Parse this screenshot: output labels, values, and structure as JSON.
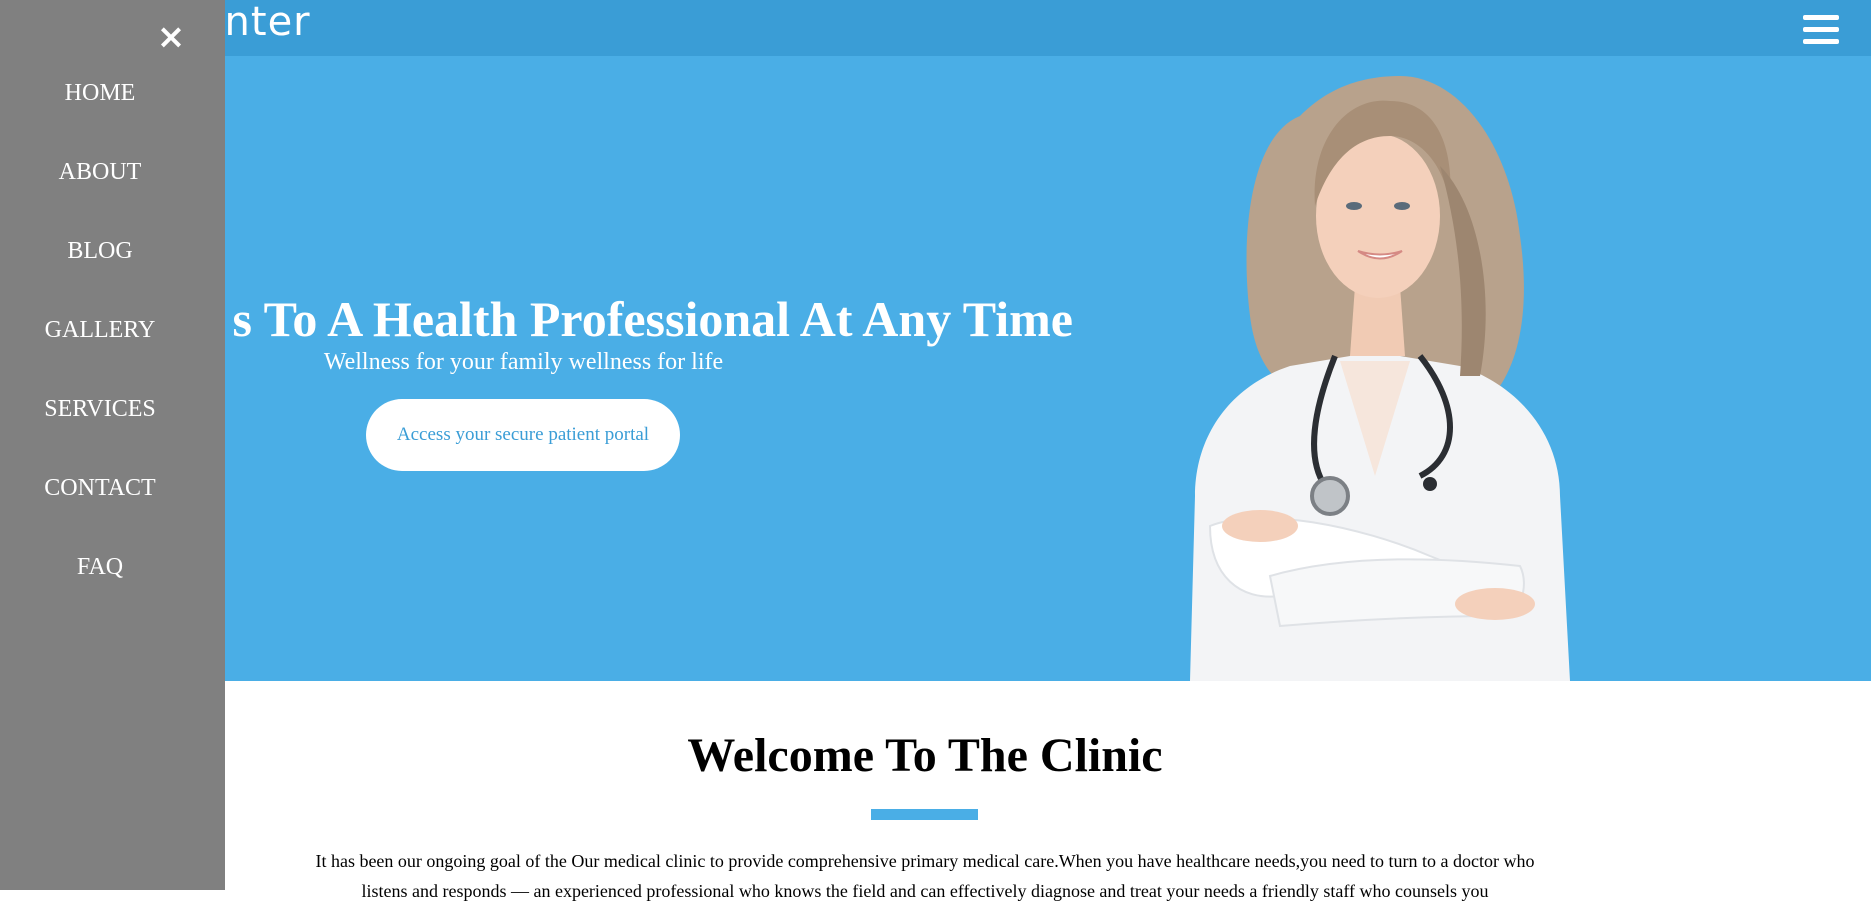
{
  "header": {
    "logo_text": "Center"
  },
  "sidebar": {
    "close_symbol": "×",
    "items": [
      {
        "label": "HOME"
      },
      {
        "label": "ABOUT"
      },
      {
        "label": "BLOG"
      },
      {
        "label": "GALLERY"
      },
      {
        "label": "SERVICES"
      },
      {
        "label": "CONTACT"
      },
      {
        "label": "FAQ"
      }
    ]
  },
  "hero": {
    "title": "s To A Health Professional At Any Time",
    "subtitle": "Wellness for your family wellness for life",
    "cta_label": "Access your secure patient portal"
  },
  "welcome": {
    "title": "Welcome To The Clinic",
    "text": "It has been our ongoing goal of the Our medical clinic to provide comprehensive primary medical care.When you have healthcare needs,you need to turn to a doctor who listens and responds — an experienced professional who knows the field and can effectively diagnose and treat your needs a friendly staff who counsels you"
  },
  "colors": {
    "topbar": "#3a9dd6",
    "hero_bg": "#4aaee6",
    "sidebar_bg": "#808080",
    "accent": "#4aaee6"
  },
  "icons": {
    "menu": "hamburger-menu-icon",
    "close": "close-icon"
  }
}
